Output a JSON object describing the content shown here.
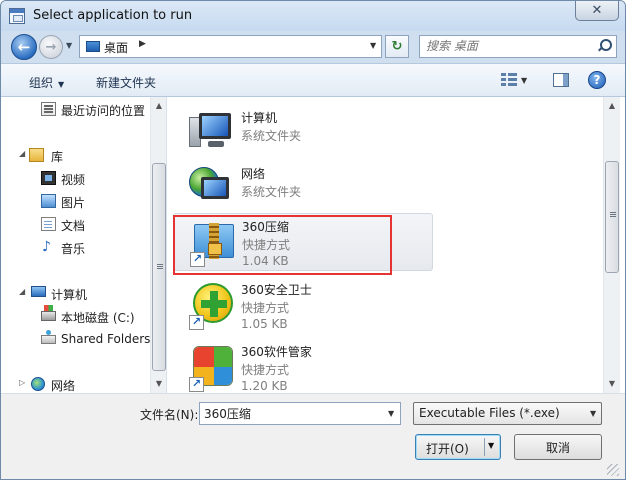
{
  "window": {
    "title": "Select application to run",
    "close_glyph": "✕"
  },
  "nav": {
    "back_glyph": "←",
    "forward_glyph": "→",
    "address": "桌面",
    "search_placeholder": "搜索 桌面"
  },
  "toolbar": {
    "organize": "组织",
    "new_folder": "新建文件夹",
    "help_glyph": "?"
  },
  "sidebar": {
    "items": [
      {
        "label": "最近访问的位置",
        "icon": "recent-places-icon"
      },
      {
        "label": "库",
        "icon": "library-icon"
      },
      {
        "label": "视频",
        "icon": "video-icon"
      },
      {
        "label": "图片",
        "icon": "pictures-icon"
      },
      {
        "label": "文档",
        "icon": "documents-icon"
      },
      {
        "label": "音乐",
        "icon": "music-icon"
      },
      {
        "label": "计算机",
        "icon": "computer-icon"
      },
      {
        "label": "本地磁盘 (C:)",
        "icon": "local-disk-icon"
      },
      {
        "label": "Shared Folders",
        "icon": "shared-folders-icon"
      },
      {
        "label": "网络",
        "icon": "network-icon"
      }
    ]
  },
  "files": {
    "items": [
      {
        "name": "计算机",
        "type": "系统文件夹",
        "size": "",
        "icon": "computer-icon"
      },
      {
        "name": "网络",
        "type": "系统文件夹",
        "size": "",
        "icon": "network-icon"
      },
      {
        "name": "360压缩",
        "type": "快捷方式",
        "size": "1.04 KB",
        "icon": "zip-folder-icon"
      },
      {
        "name": "360安全卫士",
        "type": "快捷方式",
        "size": "1.05 KB",
        "icon": "security-guard-icon"
      },
      {
        "name": "360软件管家",
        "type": "快捷方式",
        "size": "1.20 KB",
        "icon": "software-manager-icon"
      }
    ]
  },
  "form": {
    "filename_label": "文件名(N):",
    "filename_value": "360压缩",
    "filetype": "Executable Files (*.exe)",
    "open_label": "打开(O)",
    "cancel_label": "取消"
  },
  "colors": {
    "highlight": "#e53333",
    "accent": "#3c7fb1"
  }
}
